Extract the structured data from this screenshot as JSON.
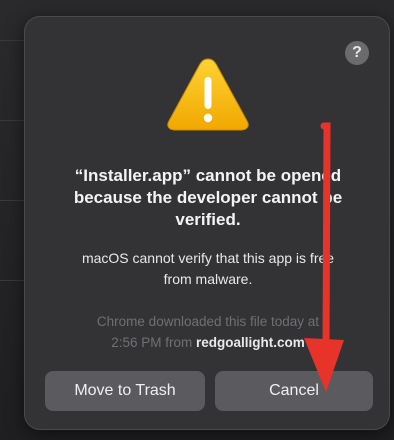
{
  "dialog": {
    "help_icon": "question-mark-icon",
    "help_label": "?",
    "warning_icon": "warning-triangle-icon",
    "warning_glyph": "!",
    "title_lines": [
      "“Installer.app” cannot be opened",
      "because the developer cannot be",
      "verified."
    ],
    "message_lines": [
      "macOS cannot verify that this app is free",
      "from malware."
    ],
    "source_line1": "Chrome downloaded this file today at",
    "source_time": "2:56 PM from ",
    "source_domain": "redgoallight.com",
    "buttons": {
      "move_to_trash": "Move to Trash",
      "cancel": "Cancel"
    }
  },
  "overlay": {
    "arrow_icon": "red-arrow-down-icon"
  },
  "colors": {
    "dialog_bg": "#333336",
    "button_bg": "#5b5b5f",
    "warning_yellow": "#f2b400",
    "arrow_red": "#e8332b"
  }
}
